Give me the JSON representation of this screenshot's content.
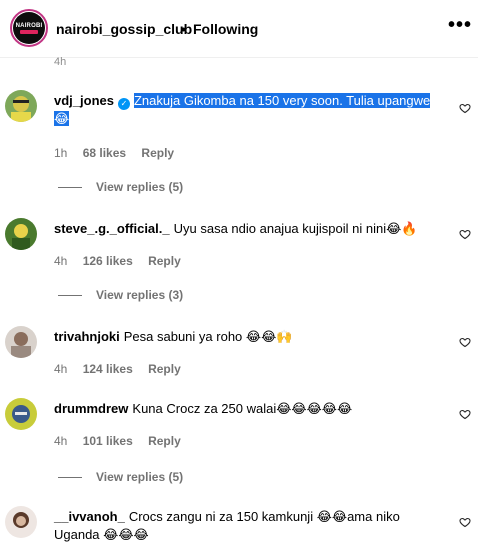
{
  "header": {
    "avatar_text": "NAIROBI",
    "username": "nairobi_gossip_club",
    "separator": "•",
    "following": "Following",
    "more": "•••"
  },
  "top_time": "4h",
  "comments": [
    {
      "username": "vdj_jones",
      "verified": true,
      "text": "Znakuja Gikomba na 150 very soon. Tulia upangwe😂",
      "time": "1h",
      "likes": "68 likes",
      "reply": "Reply",
      "view_replies": "View replies (5)",
      "avatar_color": "#d8c64a"
    },
    {
      "username": "steve_.g._official._",
      "text": "Uyu sasa ndio anajua kujispoil ni nini😂🔥",
      "time": "4h",
      "likes": "126 likes",
      "reply": "Reply",
      "view_replies": "View replies (3)",
      "avatar_color": "#4a7a2e"
    },
    {
      "username": "trivahnjoki",
      "text": "Pesa sabuni ya roho 😂😂🙌",
      "time": "4h",
      "likes": "124 likes",
      "reply": "Reply",
      "avatar_color": "#b8a9a0"
    },
    {
      "username": "drummdrew",
      "text": "Kuna Crocz za 250 walai😂😂😂😂😂",
      "time": "4h",
      "likes": "101 likes",
      "reply": "Reply",
      "view_replies": "View replies (5)",
      "avatar_color": "#c8cc3a"
    },
    {
      "username": "__ivvanoh_",
      "text": "Crocs zangu ni za 150 kamkunji 😂😂ama niko Uganda 😂😂😂",
      "avatar_color": "#e8ddd8"
    }
  ],
  "colors": {
    "highlight": "#1a73e8",
    "meta_gray": "#737373",
    "verified_blue": "#0095f6"
  },
  "icons": [
    "more-icon",
    "heart-icon",
    "verified-icon"
  ]
}
